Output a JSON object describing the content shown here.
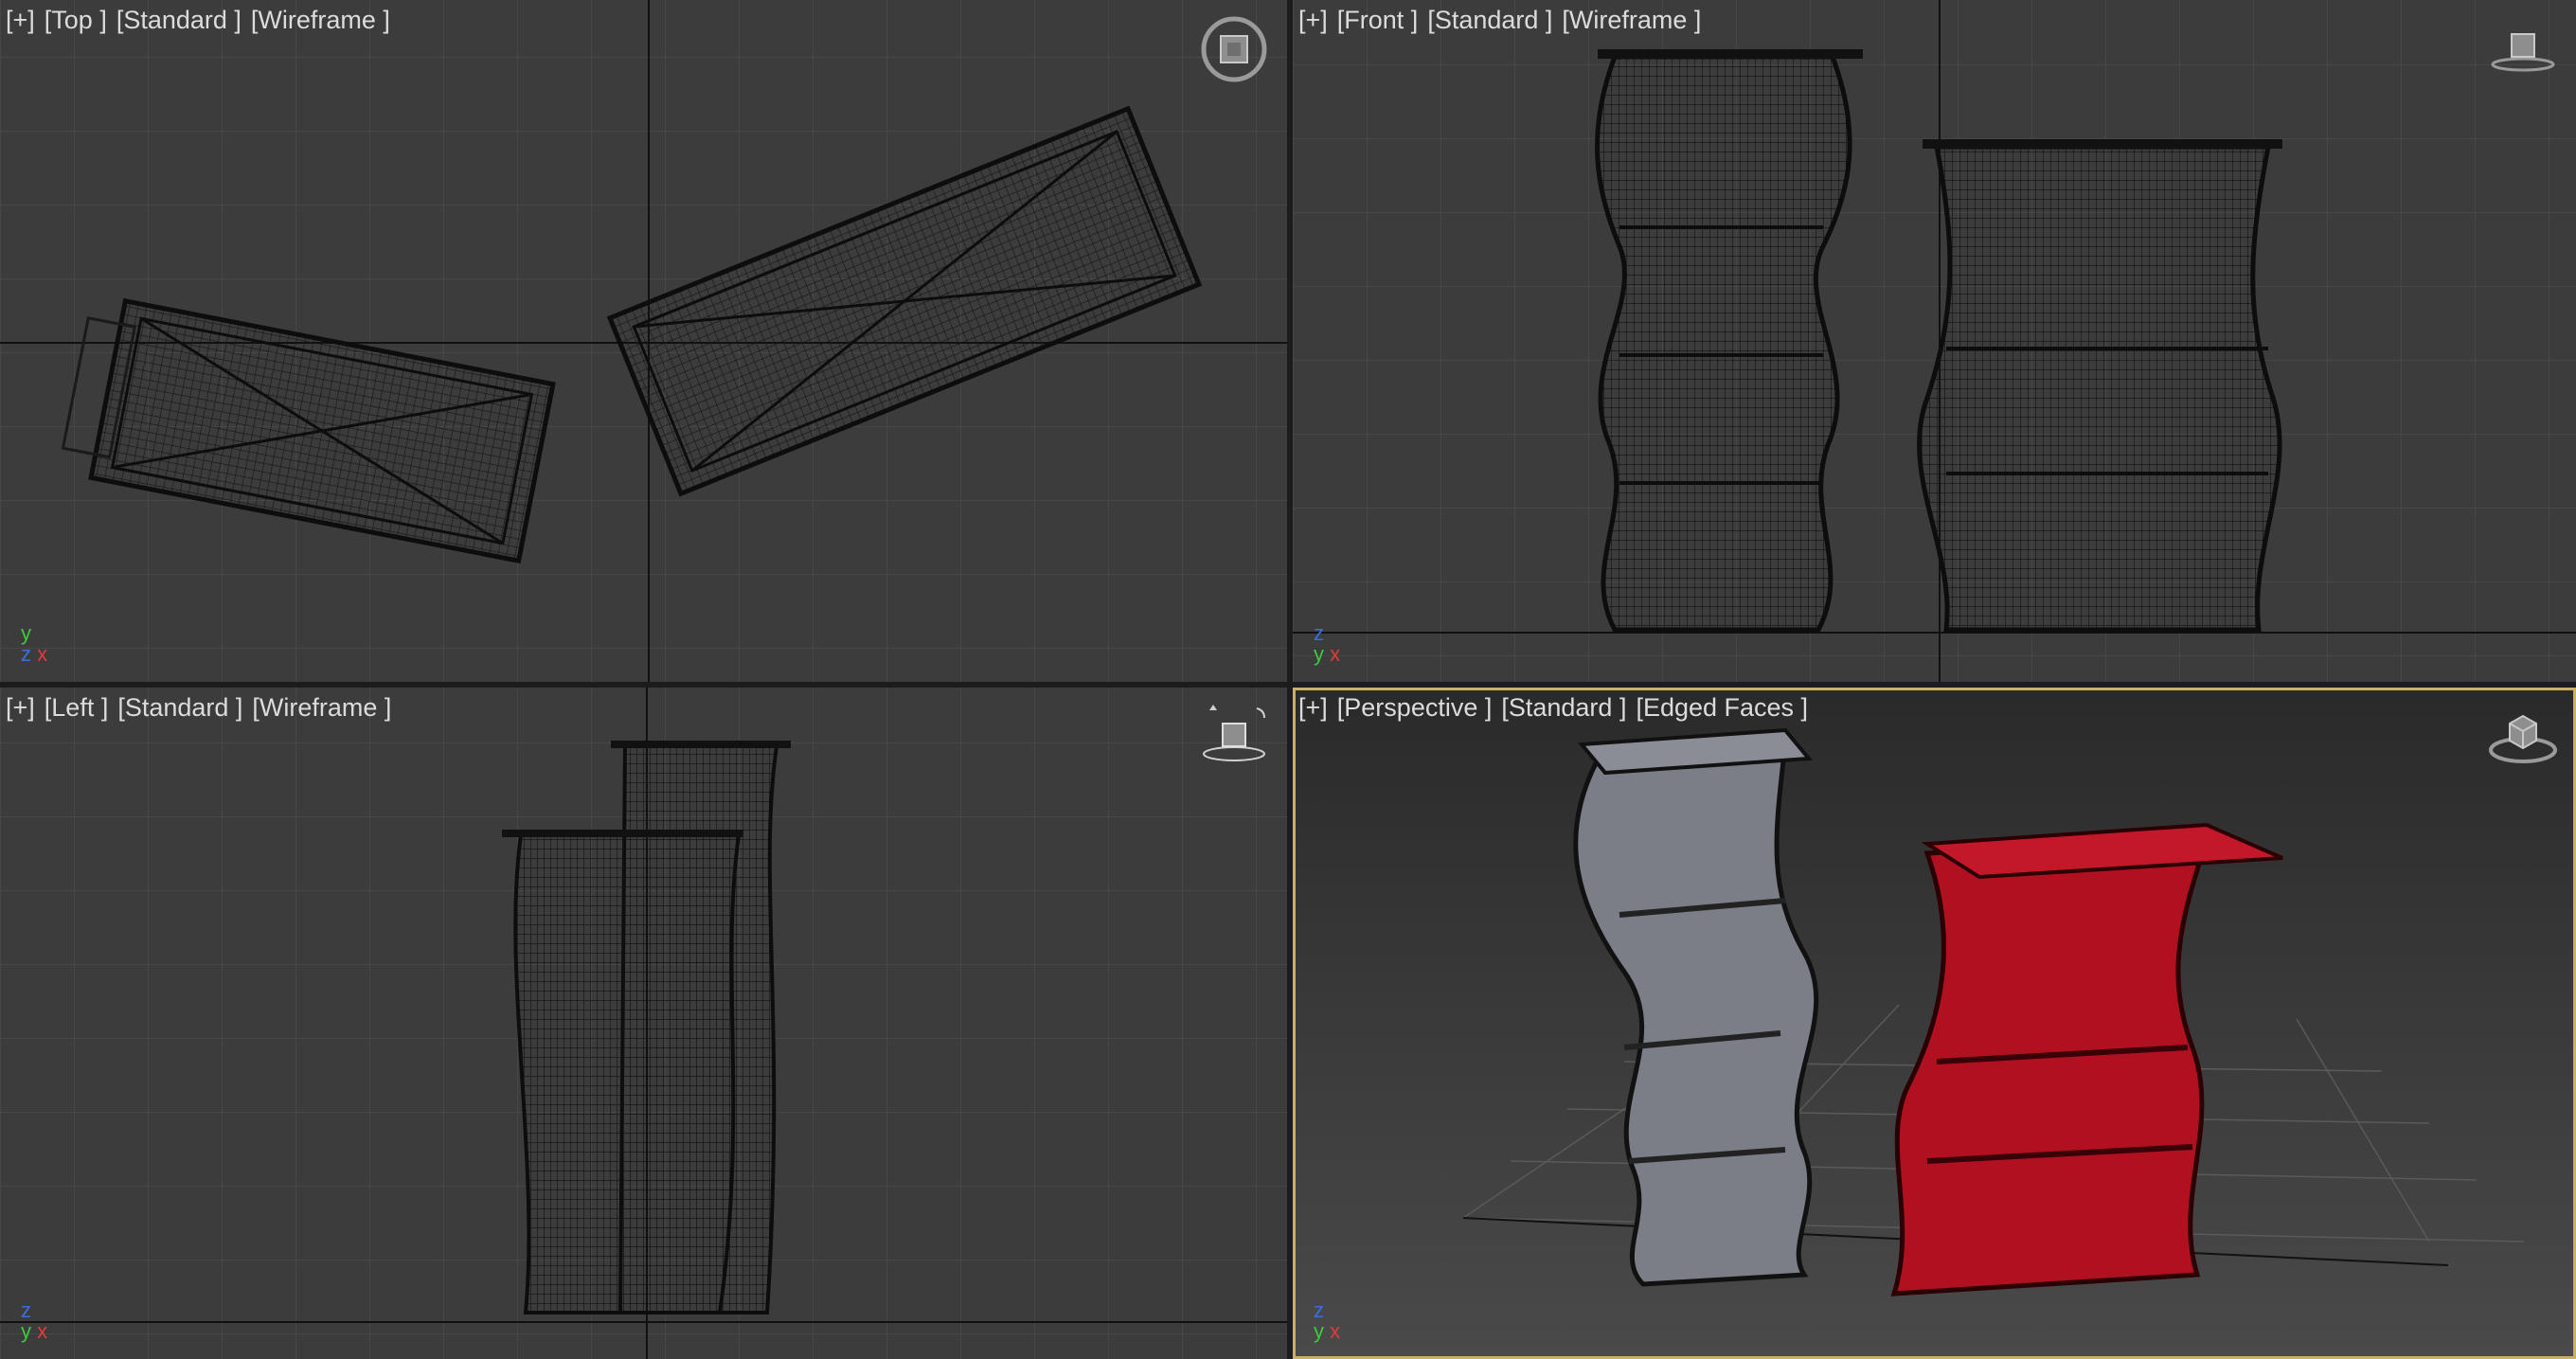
{
  "viewports": {
    "top": {
      "plus": "[+]",
      "view": "[Top ]",
      "style": "[Standard ]",
      "shading": "[Wireframe ]",
      "axes": {
        "a": "y",
        "b": "z",
        "c": "x"
      }
    },
    "front": {
      "plus": "[+]",
      "view": "[Front ]",
      "style": "[Standard ]",
      "shading": "[Wireframe ]",
      "axes": {
        "a": "z",
        "b": "y",
        "c": "x"
      }
    },
    "left": {
      "plus": "[+]",
      "view": "[Left ]",
      "style": "[Standard ]",
      "shading": "[Wireframe ]",
      "axes": {
        "a": "z",
        "b": "y",
        "c": "x"
      }
    },
    "persp": {
      "plus": "[+]",
      "view": "[Perspective ]",
      "style": "[Standard ]",
      "shading": "[Edged Faces ]",
      "axes": {
        "a": "z",
        "b": "y",
        "c": "x"
      }
    }
  },
  "colors": {
    "viewport_bg": "#3c3c3c",
    "grid": "#4a4a4a",
    "wire": "#0e0e0e",
    "active_border": "#c8b067",
    "object_gray": "#7b7d87",
    "object_red": "#b01020"
  },
  "icons": {
    "navigation": "viewcube-icon",
    "steering": "steeringwheel-icon"
  }
}
